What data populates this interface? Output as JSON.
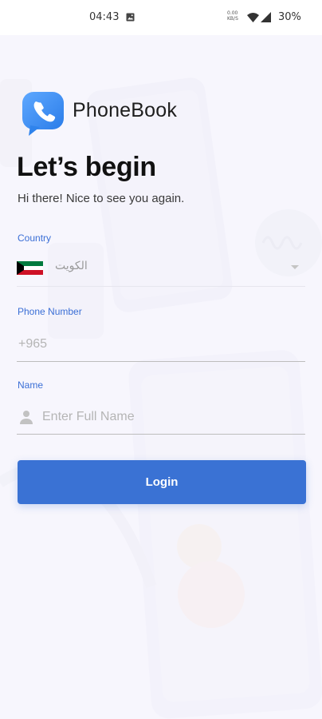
{
  "status_bar": {
    "time": "04:43",
    "data_rate": "0.00\nKB/S",
    "battery": "30%"
  },
  "app": {
    "name": "PhoneBook",
    "logo_icon": "phone-chat-bubble-icon",
    "accent_color": "#3a72d4"
  },
  "header": {
    "title": "Let’s begin",
    "subtitle": "Hi there! Nice to see you again."
  },
  "form": {
    "country": {
      "label": "Country",
      "value": "الكويت",
      "flag_icon": "kuwait-flag-icon"
    },
    "phone": {
      "label": "Phone Number",
      "placeholder": "+965",
      "value": ""
    },
    "name": {
      "label": "Name",
      "placeholder": "Enter Full Name",
      "value": "",
      "icon": "person-icon"
    },
    "login_label": "Login"
  }
}
